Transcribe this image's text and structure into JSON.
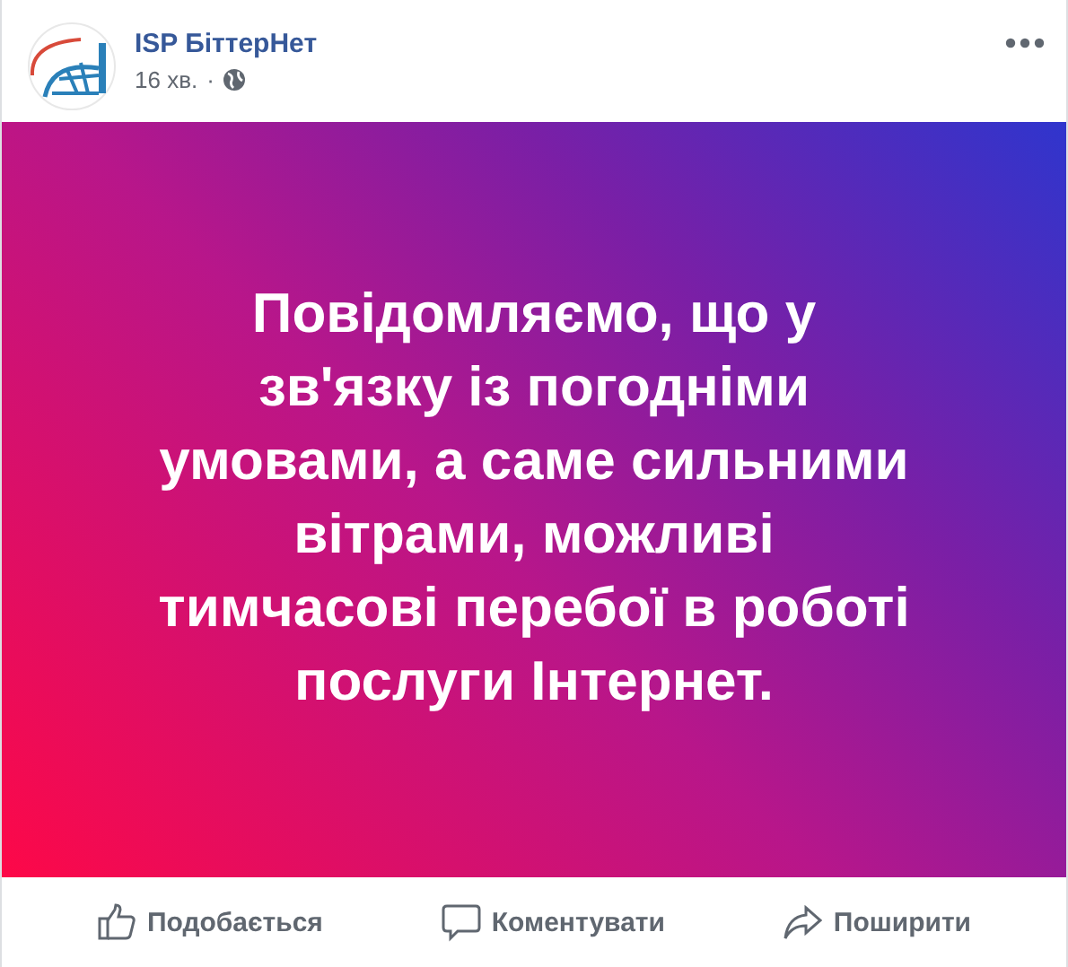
{
  "post": {
    "author": "ISP БіттерНет",
    "time": "16 хв.",
    "separator": "·",
    "message_lines": [
      "Повідомляємо, що у",
      "зв'язку із погодніми",
      "умовами, а саме сильними",
      "вітрами, можливі",
      "тимчасові перебої в роботі",
      "послуги Інтернет."
    ]
  },
  "actions": [
    {
      "kind": "like",
      "label": "Подобається"
    },
    {
      "kind": "comment",
      "label": "Коментувати"
    },
    {
      "kind": "share",
      "label": "Поширити"
    }
  ]
}
